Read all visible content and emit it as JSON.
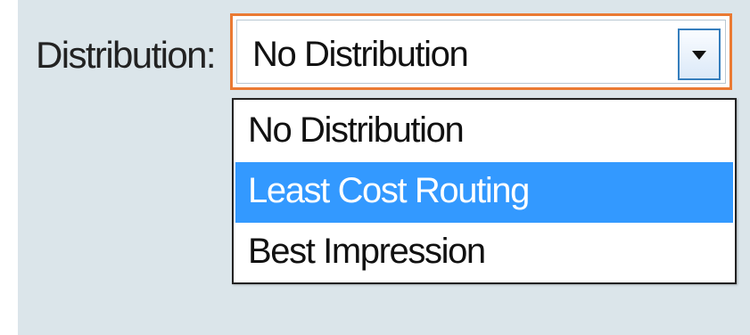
{
  "form": {
    "distribution_label": "Distribution:",
    "selected_value": "No Distribution",
    "options": [
      {
        "label": "No Distribution",
        "highlighted": false
      },
      {
        "label": "Least Cost Routing",
        "highlighted": true
      },
      {
        "label": "Best Impression",
        "highlighted": false
      }
    ]
  },
  "colors": {
    "panel_background": "#dbe5ea",
    "focus_border": "#ea7a33",
    "highlight": "#3399ff",
    "dropdown_button_border": "#357ebd"
  },
  "icons": {
    "dropdown": "chevron-down-icon"
  }
}
